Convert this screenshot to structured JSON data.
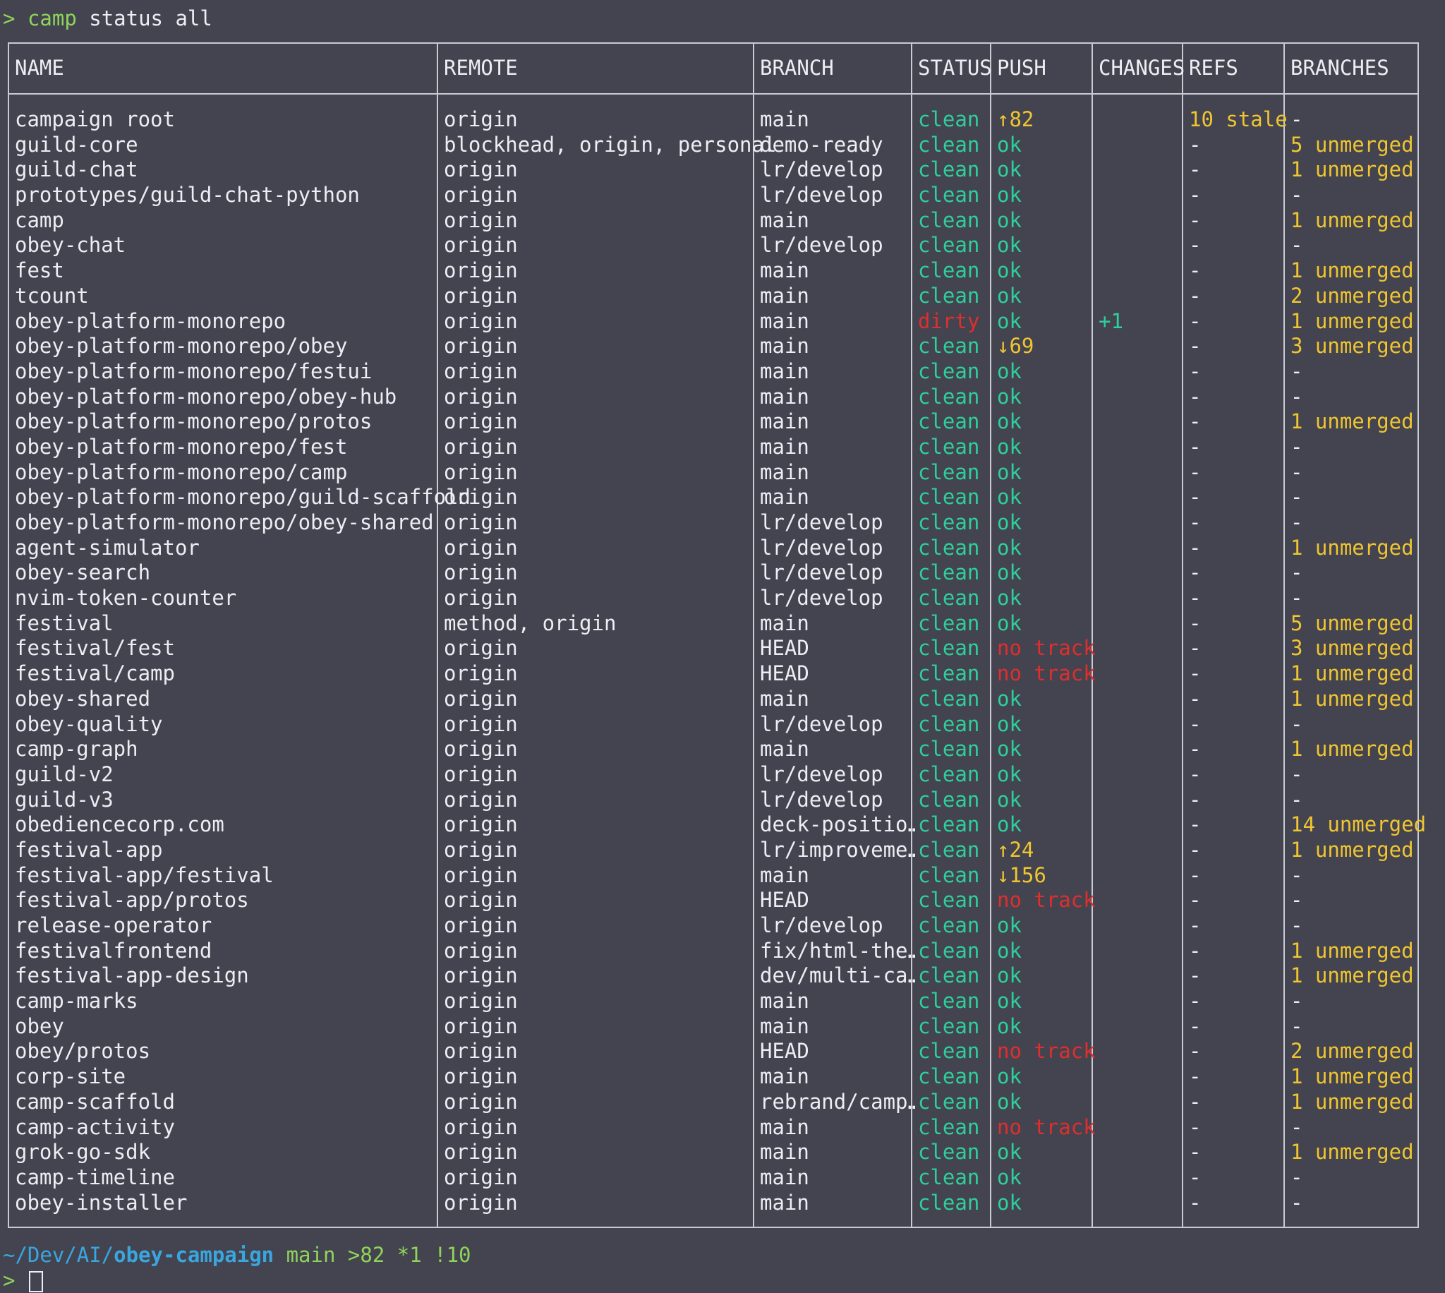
{
  "command": {
    "caret": ">",
    "name": "camp",
    "args": "status all"
  },
  "columns": [
    "NAME",
    "REMOTE",
    "BRANCH",
    "STATUS",
    "PUSH",
    "CHANGES",
    "REFS",
    "BRANCHES"
  ],
  "rows": [
    {
      "name": "campaign root",
      "remote": "origin",
      "branch": "main",
      "status": "clean",
      "push": "↑82",
      "push_kind": "ahead",
      "changes": "",
      "refs": "10 stale",
      "branches": "-"
    },
    {
      "name": "guild-core",
      "remote": "blockhead, origin, personal",
      "branch": "demo-ready",
      "status": "clean",
      "push": "ok",
      "push_kind": "ok",
      "changes": "",
      "refs": "-",
      "branches": "5 unmerged"
    },
    {
      "name": "guild-chat",
      "remote": "origin",
      "branch": "lr/develop",
      "status": "clean",
      "push": "ok",
      "push_kind": "ok",
      "changes": "",
      "refs": "-",
      "branches": "1 unmerged"
    },
    {
      "name": "prototypes/guild-chat-python",
      "remote": "origin",
      "branch": "lr/develop",
      "status": "clean",
      "push": "ok",
      "push_kind": "ok",
      "changes": "",
      "refs": "-",
      "branches": "-"
    },
    {
      "name": "camp",
      "remote": "origin",
      "branch": "main",
      "status": "clean",
      "push": "ok",
      "push_kind": "ok",
      "changes": "",
      "refs": "-",
      "branches": "1 unmerged"
    },
    {
      "name": "obey-chat",
      "remote": "origin",
      "branch": "lr/develop",
      "status": "clean",
      "push": "ok",
      "push_kind": "ok",
      "changes": "",
      "refs": "-",
      "branches": "-"
    },
    {
      "name": "fest",
      "remote": "origin",
      "branch": "main",
      "status": "clean",
      "push": "ok",
      "push_kind": "ok",
      "changes": "",
      "refs": "-",
      "branches": "1 unmerged"
    },
    {
      "name": "tcount",
      "remote": "origin",
      "branch": "main",
      "status": "clean",
      "push": "ok",
      "push_kind": "ok",
      "changes": "",
      "refs": "-",
      "branches": "2 unmerged"
    },
    {
      "name": "obey-platform-monorepo",
      "remote": "origin",
      "branch": "main",
      "status": "dirty",
      "push": "ok",
      "push_kind": "ok",
      "changes": "+1",
      "refs": "-",
      "branches": "1 unmerged"
    },
    {
      "name": "obey-platform-monorepo/obey",
      "remote": "origin",
      "branch": "main",
      "status": "clean",
      "push": "↓69",
      "push_kind": "behind",
      "changes": "",
      "refs": "-",
      "branches": "3 unmerged"
    },
    {
      "name": "obey-platform-monorepo/festui",
      "remote": "origin",
      "branch": "main",
      "status": "clean",
      "push": "ok",
      "push_kind": "ok",
      "changes": "",
      "refs": "-",
      "branches": "-"
    },
    {
      "name": "obey-platform-monorepo/obey-hub",
      "remote": "origin",
      "branch": "main",
      "status": "clean",
      "push": "ok",
      "push_kind": "ok",
      "changes": "",
      "refs": "-",
      "branches": "-"
    },
    {
      "name": "obey-platform-monorepo/protos",
      "remote": "origin",
      "branch": "main",
      "status": "clean",
      "push": "ok",
      "push_kind": "ok",
      "changes": "",
      "refs": "-",
      "branches": "1 unmerged"
    },
    {
      "name": "obey-platform-monorepo/fest",
      "remote": "origin",
      "branch": "main",
      "status": "clean",
      "push": "ok",
      "push_kind": "ok",
      "changes": "",
      "refs": "-",
      "branches": "-"
    },
    {
      "name": "obey-platform-monorepo/camp",
      "remote": "origin",
      "branch": "main",
      "status": "clean",
      "push": "ok",
      "push_kind": "ok",
      "changes": "",
      "refs": "-",
      "branches": "-"
    },
    {
      "name": "obey-platform-monorepo/guild-scaffold",
      "remote": "origin",
      "branch": "main",
      "status": "clean",
      "push": "ok",
      "push_kind": "ok",
      "changes": "",
      "refs": "-",
      "branches": "-"
    },
    {
      "name": "obey-platform-monorepo/obey-shared",
      "remote": "origin",
      "branch": "lr/develop",
      "status": "clean",
      "push": "ok",
      "push_kind": "ok",
      "changes": "",
      "refs": "-",
      "branches": "-"
    },
    {
      "name": "agent-simulator",
      "remote": "origin",
      "branch": "lr/develop",
      "status": "clean",
      "push": "ok",
      "push_kind": "ok",
      "changes": "",
      "refs": "-",
      "branches": "1 unmerged"
    },
    {
      "name": "obey-search",
      "remote": "origin",
      "branch": "lr/develop",
      "status": "clean",
      "push": "ok",
      "push_kind": "ok",
      "changes": "",
      "refs": "-",
      "branches": "-"
    },
    {
      "name": "nvim-token-counter",
      "remote": "origin",
      "branch": "lr/develop",
      "status": "clean",
      "push": "ok",
      "push_kind": "ok",
      "changes": "",
      "refs": "-",
      "branches": "-"
    },
    {
      "name": "festival",
      "remote": "method, origin",
      "branch": "main",
      "status": "clean",
      "push": "ok",
      "push_kind": "ok",
      "changes": "",
      "refs": "-",
      "branches": "5 unmerged"
    },
    {
      "name": "festival/fest",
      "remote": "origin",
      "branch": "HEAD",
      "status": "clean",
      "push": "no track",
      "push_kind": "notrack",
      "changes": "",
      "refs": "-",
      "branches": "3 unmerged"
    },
    {
      "name": "festival/camp",
      "remote": "origin",
      "branch": "HEAD",
      "status": "clean",
      "push": "no track",
      "push_kind": "notrack",
      "changes": "",
      "refs": "-",
      "branches": "1 unmerged"
    },
    {
      "name": "obey-shared",
      "remote": "origin",
      "branch": "main",
      "status": "clean",
      "push": "ok",
      "push_kind": "ok",
      "changes": "",
      "refs": "-",
      "branches": "1 unmerged"
    },
    {
      "name": "obey-quality",
      "remote": "origin",
      "branch": "lr/develop",
      "status": "clean",
      "push": "ok",
      "push_kind": "ok",
      "changes": "",
      "refs": "-",
      "branches": "-"
    },
    {
      "name": "camp-graph",
      "remote": "origin",
      "branch": "main",
      "status": "clean",
      "push": "ok",
      "push_kind": "ok",
      "changes": "",
      "refs": "-",
      "branches": "1 unmerged"
    },
    {
      "name": "guild-v2",
      "remote": "origin",
      "branch": "lr/develop",
      "status": "clean",
      "push": "ok",
      "push_kind": "ok",
      "changes": "",
      "refs": "-",
      "branches": "-"
    },
    {
      "name": "guild-v3",
      "remote": "origin",
      "branch": "lr/develop",
      "status": "clean",
      "push": "ok",
      "push_kind": "ok",
      "changes": "",
      "refs": "-",
      "branches": "-"
    },
    {
      "name": "obediencecorp.com",
      "remote": "origin",
      "branch": "deck-positio…",
      "status": "clean",
      "push": "ok",
      "push_kind": "ok",
      "changes": "",
      "refs": "-",
      "branches": "14 unmerged"
    },
    {
      "name": "festival-app",
      "remote": "origin",
      "branch": "lr/improveme…",
      "status": "clean",
      "push": "↑24",
      "push_kind": "ahead",
      "changes": "",
      "refs": "-",
      "branches": "1 unmerged"
    },
    {
      "name": "festival-app/festival",
      "remote": "origin",
      "branch": "main",
      "status": "clean",
      "push": "↓156",
      "push_kind": "behind",
      "changes": "",
      "refs": "-",
      "branches": "-"
    },
    {
      "name": "festival-app/protos",
      "remote": "origin",
      "branch": "HEAD",
      "status": "clean",
      "push": "no track",
      "push_kind": "notrack",
      "changes": "",
      "refs": "-",
      "branches": "-"
    },
    {
      "name": "release-operator",
      "remote": "origin",
      "branch": "lr/develop",
      "status": "clean",
      "push": "ok",
      "push_kind": "ok",
      "changes": "",
      "refs": "-",
      "branches": "-"
    },
    {
      "name": "festivalfrontend",
      "remote": "origin",
      "branch": "fix/html-the…",
      "status": "clean",
      "push": "ok",
      "push_kind": "ok",
      "changes": "",
      "refs": "-",
      "branches": "1 unmerged"
    },
    {
      "name": "festival-app-design",
      "remote": "origin",
      "branch": "dev/multi-ca…",
      "status": "clean",
      "push": "ok",
      "push_kind": "ok",
      "changes": "",
      "refs": "-",
      "branches": "1 unmerged"
    },
    {
      "name": "camp-marks",
      "remote": "origin",
      "branch": "main",
      "status": "clean",
      "push": "ok",
      "push_kind": "ok",
      "changes": "",
      "refs": "-",
      "branches": "-"
    },
    {
      "name": "obey",
      "remote": "origin",
      "branch": "main",
      "status": "clean",
      "push": "ok",
      "push_kind": "ok",
      "changes": "",
      "refs": "-",
      "branches": "-"
    },
    {
      "name": "obey/protos",
      "remote": "origin",
      "branch": "HEAD",
      "status": "clean",
      "push": "no track",
      "push_kind": "notrack",
      "changes": "",
      "refs": "-",
      "branches": "2 unmerged"
    },
    {
      "name": "corp-site",
      "remote": "origin",
      "branch": "main",
      "status": "clean",
      "push": "ok",
      "push_kind": "ok",
      "changes": "",
      "refs": "-",
      "branches": "1 unmerged"
    },
    {
      "name": "camp-scaffold",
      "remote": "origin",
      "branch": "rebrand/camp…",
      "status": "clean",
      "push": "ok",
      "push_kind": "ok",
      "changes": "",
      "refs": "-",
      "branches": "1 unmerged"
    },
    {
      "name": "camp-activity",
      "remote": "origin",
      "branch": "main",
      "status": "clean",
      "push": "no track",
      "push_kind": "notrack",
      "changes": "",
      "refs": "-",
      "branches": "-"
    },
    {
      "name": "grok-go-sdk",
      "remote": "origin",
      "branch": "main",
      "status": "clean",
      "push": "ok",
      "push_kind": "ok",
      "changes": "",
      "refs": "-",
      "branches": "1 unmerged"
    },
    {
      "name": "camp-timeline",
      "remote": "origin",
      "branch": "main",
      "status": "clean",
      "push": "ok",
      "push_kind": "ok",
      "changes": "",
      "refs": "-",
      "branches": "-"
    },
    {
      "name": "obey-installer",
      "remote": "origin",
      "branch": "main",
      "status": "clean",
      "push": "ok",
      "push_kind": "ok",
      "changes": "",
      "refs": "-",
      "branches": "-"
    }
  ],
  "prompt": {
    "path_prefix": "~/Dev/AI/",
    "path_dir": "obey-campaign",
    "branch": "main",
    "stats": ">82 *1 !10",
    "caret": ">"
  },
  "colors": {
    "background": "#43444f",
    "clean": "#2fcf9c",
    "dirty": "#e02e2e",
    "warn": "#f0c531",
    "path": "#3aa6e0",
    "prompt": "#8fd45a"
  }
}
